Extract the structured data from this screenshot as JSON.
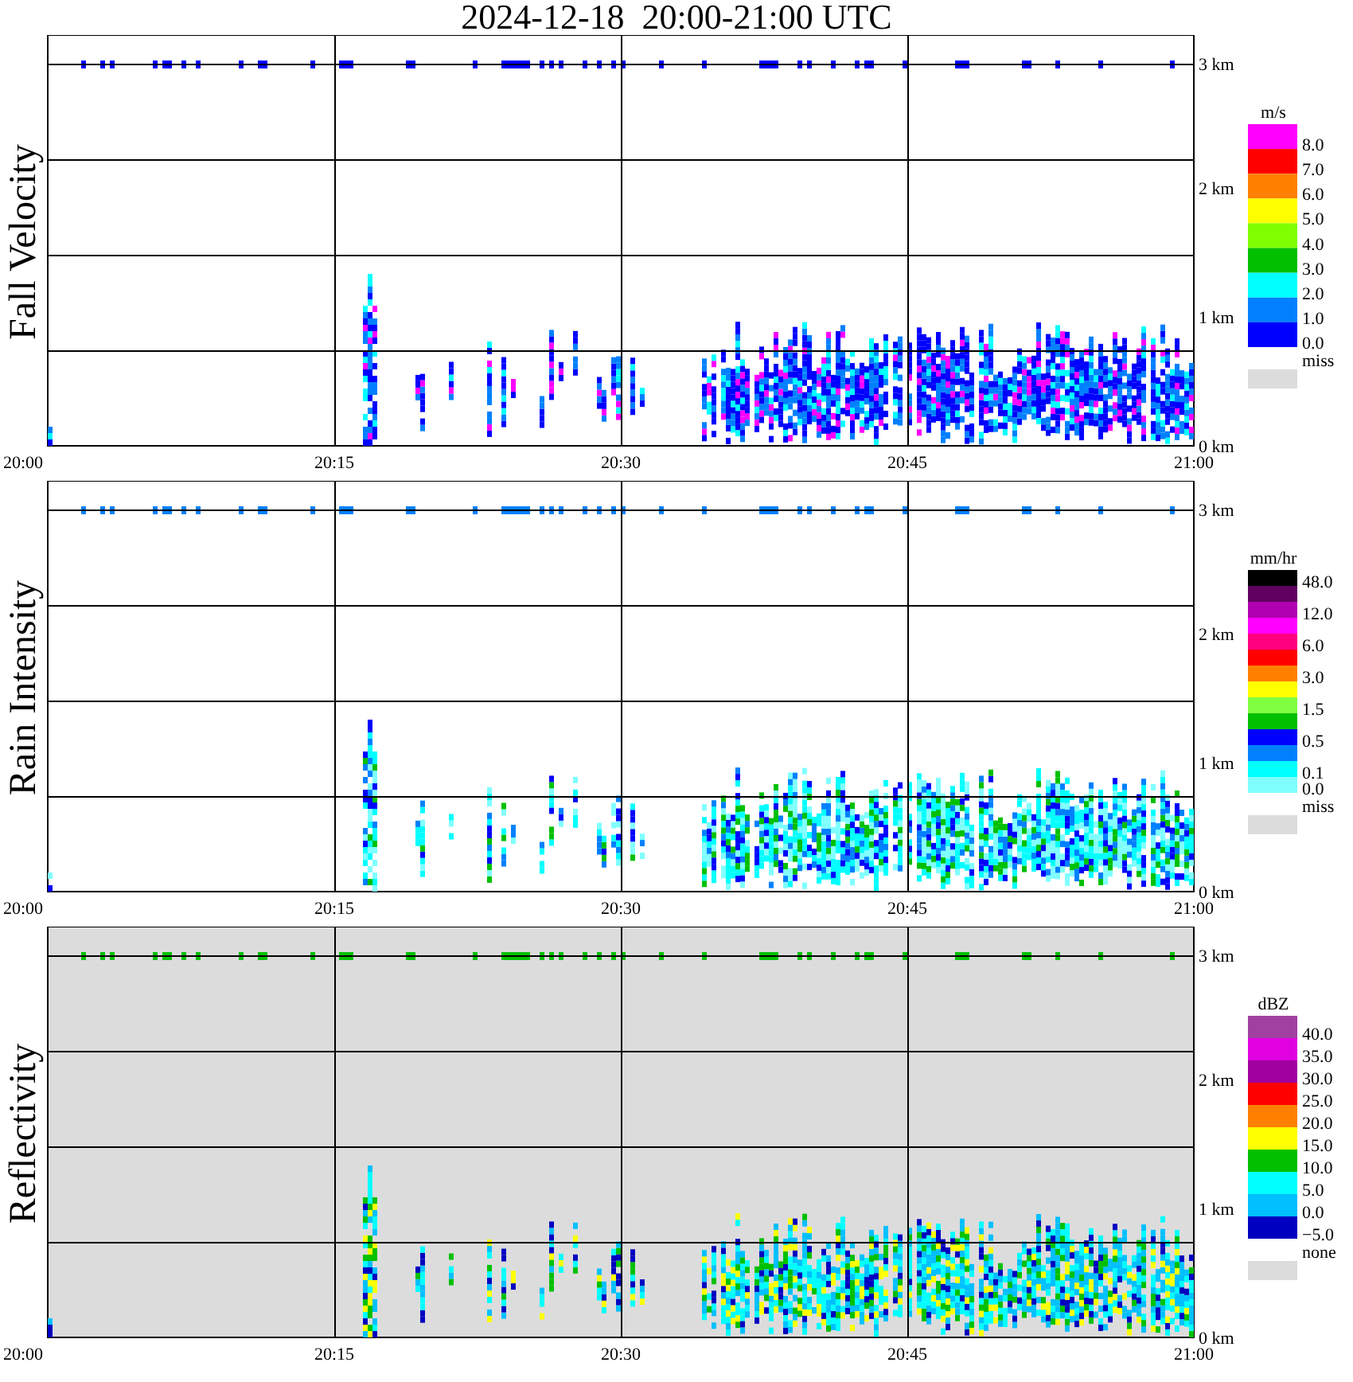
{
  "title": "2024-12-18  20:00-21:00 UTC",
  "panels": [
    {
      "kind": "velocity",
      "ylabel": "Fall Velocity",
      "times": [
        "20:00",
        "20:15",
        "20:30",
        "20:45",
        "21:00"
      ],
      "heights": [
        "3 km",
        "2 km",
        "1 km",
        "0 km"
      ],
      "legend": {
        "unit": "m/s",
        "swatches": [
          {
            "color": "#ff00ff",
            "label": "8.0"
          },
          {
            "color": "#ff0000",
            "label": "7.0"
          },
          {
            "color": "#ff8000",
            "label": "6.0"
          },
          {
            "color": "#ffff00",
            "label": "5.0"
          },
          {
            "color": "#80ff00",
            "label": "4.0"
          },
          {
            "color": "#00c000",
            "label": "3.0"
          },
          {
            "color": "#00ffff",
            "label": "2.0"
          },
          {
            "color": "#0080ff",
            "label": "1.0"
          },
          {
            "color": "#0000ff",
            "label": "0.0"
          }
        ],
        "missing": {
          "color": "#dcdcdc",
          "label": "miss"
        }
      }
    },
    {
      "kind": "rain",
      "ylabel": "Rain Intensity",
      "times": [
        "20:00",
        "20:15",
        "20:30",
        "20:45",
        "21:00"
      ],
      "heights": [
        "3 km",
        "2 km",
        "1 km",
        "0 km"
      ],
      "legend": {
        "unit": "mm/hr",
        "swatches": [
          {
            "color": "#000000",
            "label": "48.0"
          },
          {
            "color": "#600060"
          },
          {
            "color": "#b000b0",
            "label": "12.0"
          },
          {
            "color": "#ff00ff"
          },
          {
            "color": "#ff0080",
            "label": "6.0"
          },
          {
            "color": "#ff0000"
          },
          {
            "color": "#ff8000",
            "label": "3.0"
          },
          {
            "color": "#ffff00"
          },
          {
            "color": "#80ff40",
            "label": "1.5"
          },
          {
            "color": "#00c000"
          },
          {
            "color": "#0000ff",
            "label": "0.5"
          },
          {
            "color": "#0080ff"
          },
          {
            "color": "#00ffff",
            "label": "0.1"
          },
          {
            "color": "#80ffff",
            "label": "0.0"
          }
        ],
        "missing": {
          "color": "#dcdcdc",
          "label": "miss"
        }
      }
    },
    {
      "kind": "reflectivity",
      "ylabel": "Reflectivity",
      "times": [
        "20:00",
        "20:15",
        "20:30",
        "20:45",
        "21:00"
      ],
      "heights": [
        "3 km",
        "2 km",
        "1 km",
        "0 km"
      ],
      "legend": {
        "unit": "dBZ",
        "swatches": [
          {
            "color": "#a040a0",
            "label": "40.0"
          },
          {
            "color": "#e000e0",
            "label": "35.0"
          },
          {
            "color": "#a000a0",
            "label": "30.0"
          },
          {
            "color": "#ff0000",
            "label": "25.0"
          },
          {
            "color": "#ff8000",
            "label": "20.0"
          },
          {
            "color": "#ffff00",
            "label": "15.0"
          },
          {
            "color": "#00c000",
            "label": "10.0"
          },
          {
            "color": "#00ffff",
            "label": "5.0"
          },
          {
            "color": "#00c0ff",
            "label": "0.0"
          },
          {
            "color": "#0000c0",
            "label": "−5.0"
          }
        ],
        "missing": {
          "color": "#dcdcdc",
          "label": "none"
        }
      }
    }
  ]
}
